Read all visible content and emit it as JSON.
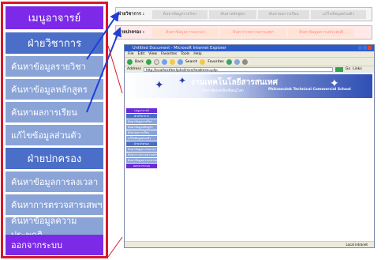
{
  "left_menu": {
    "items": [
      {
        "label": "เมนูอาจารย์",
        "kind": "head",
        "color": "purple"
      },
      {
        "label": "ฝ่ายวิชาการ",
        "kind": "head",
        "color": "blue"
      },
      {
        "label": "ค้นหาข้อมูลรายวิชา",
        "kind": "item",
        "color": "light"
      },
      {
        "label": "ค้นหาข้อมูลหลักสูตร",
        "kind": "item",
        "color": "light"
      },
      {
        "label": "ค้นหาผลการเรียน",
        "kind": "item",
        "color": "light"
      },
      {
        "label": "แก้ไขข้อมูลส่วนตัว",
        "kind": "item",
        "color": "light"
      },
      {
        "label": "ฝ่ายปกครอง",
        "kind": "head",
        "color": "blue"
      },
      {
        "label": "ค้นหาข้อมูลการลงเวลา",
        "kind": "item",
        "color": "light"
      },
      {
        "label": "ค้นหาการตรวจสารเสพฯ",
        "kind": "item",
        "color": "light"
      },
      {
        "label": "ค้นหาข้อมูลความประพฤติ",
        "kind": "item",
        "color": "light"
      },
      {
        "label": "ออกจากระบบ",
        "kind": "item",
        "color": "purple"
      }
    ]
  },
  "strip1": {
    "label": "ฝ่ายวิชาการ :",
    "cells": [
      "ค้นหาข้อมูลรายวิชา",
      "ค้นหาหลักสูตร",
      "ค้นหาผลการเรียน",
      "แก้ไขข้อมูลส่วนตัว"
    ]
  },
  "strip2": {
    "label": "ฝ่ายปกครอง :",
    "cells": [
      "ค้นหาข้อมูลการลงเวลา",
      "ค้นหาการตรวจสารเสพฯ",
      "ค้นหาข้อมูลความประพฤติ"
    ]
  },
  "browser": {
    "title": "Untitled Document - Microsoft Internet Explorer",
    "menu": [
      "File",
      "Edit",
      "View",
      "Favorites",
      "Tools",
      "Help"
    ],
    "toolbar": {
      "back": "Back",
      "search": "Search",
      "favorites": "Favorites"
    },
    "address_label": "Address",
    "address": "http://localhost/techphol/mon/headmenu.php",
    "go": "Go",
    "links": "Links",
    "banner_title": "งานเทคโนโลยีสารสนเทศ",
    "banner_subtitle": "วิทยาลัยเทคนิคพิษณุโลก",
    "banner_school": "Phitsanulok Technical Commercial School",
    "status": "Local intranet",
    "side_menu": [
      {
        "label": "เมนูอาจารย์",
        "color": "purple"
      },
      {
        "label": "ฝ่ายวิชาการ",
        "color": "blue"
      },
      {
        "label": "ค้นหาข้อมูลรายวิชา",
        "color": "light"
      },
      {
        "label": "ค้นหาข้อมูลหลักสูตร",
        "color": "light"
      },
      {
        "label": "ค้นหาผลการเรียน",
        "color": "light"
      },
      {
        "label": "แก้ไขข้อมูลส่วนตัว",
        "color": "light"
      },
      {
        "label": "ฝ่ายปกครอง",
        "color": "blue"
      },
      {
        "label": "ค้นหาข้อมูลการลงเวลา",
        "color": "light"
      },
      {
        "label": "ค้นหาการตรวจสารเสพฯ",
        "color": "light"
      },
      {
        "label": "ค้นหาข้อมูลความประพฤติ",
        "color": "light"
      },
      {
        "label": "ออกจากระบบ",
        "color": "purple"
      }
    ]
  },
  "colors": {
    "frame_red": "#d8192a",
    "purple": "#7d2ae8",
    "blue": "#4b6fc8",
    "light": "#8aa4d8",
    "arrow": "#1f3fd6"
  }
}
